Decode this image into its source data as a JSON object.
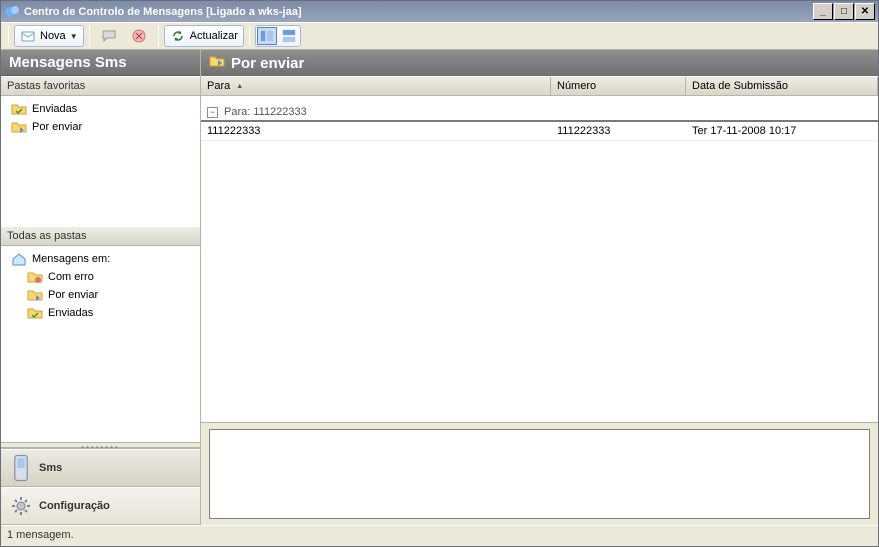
{
  "window": {
    "title": "Centro de Controlo de Mensagens [Ligado a wks-jaa]"
  },
  "toolbar": {
    "nova": "Nova",
    "actualizar": "Actualizar"
  },
  "sidebar": {
    "title": "Mensagens Sms",
    "favorites_label": "Pastas favoritas",
    "favorites": [
      {
        "label": "Enviadas"
      },
      {
        "label": "Por enviar"
      }
    ],
    "all_label": "Todas as pastas",
    "root_label": "Mensagens em:",
    "all": [
      {
        "label": "Com erro"
      },
      {
        "label": "Por enviar"
      },
      {
        "label": "Enviadas"
      }
    ],
    "nav": {
      "sms": "Sms",
      "config": "Configuração"
    }
  },
  "main": {
    "title": "Por enviar",
    "columns": {
      "para": "Para",
      "numero": "Número",
      "data": "Data de Submissão"
    },
    "group_label": "Para: 111222333",
    "row": {
      "para": "111222333",
      "numero": "111222333",
      "data": "Ter 17-11-2008 10:17"
    }
  },
  "status": "1 mensagem."
}
